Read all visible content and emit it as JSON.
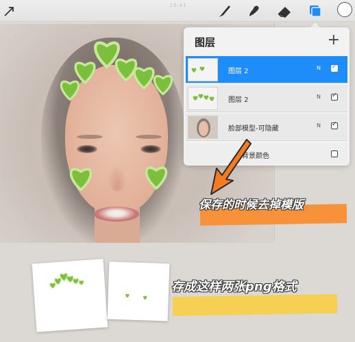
{
  "toolbar": {
    "title": "10:41",
    "tools": [
      "brush-icon",
      "smudge-icon",
      "eraser-icon",
      "layers-icon",
      "color-picker-icon"
    ],
    "active_tool": "layers-icon",
    "accent": "#1e8dfa"
  },
  "layers_panel": {
    "title": "图层",
    "add_label": "+",
    "layers": [
      {
        "name": "图层 2",
        "blend": "N",
        "visible": true,
        "selected": true
      },
      {
        "name": "图层 2",
        "blend": "N",
        "visible": true,
        "selected": false
      },
      {
        "name": "脸部模型-可隐藏",
        "blend": "N",
        "visible": true,
        "selected": false
      }
    ],
    "background": {
      "label": "背景颜色",
      "visible": false
    }
  },
  "annotations": {
    "note1": "保存的时候去掉模版",
    "note2": "存成这样两张png格式",
    "note1_color": "#f7923a",
    "note2_color": "#f6d052"
  },
  "colors": {
    "heart": "#7cbf3c",
    "heart_dark": "#4f9a2a"
  }
}
